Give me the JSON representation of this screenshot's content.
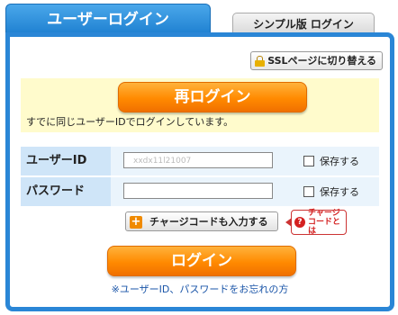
{
  "tabs": {
    "active_label": "ユーザーログイン",
    "inactive_label": "シンプル版 ログイン"
  },
  "ssl": {
    "label": "SSLページに切り替える"
  },
  "relogin": {
    "button_label": "再ログイン",
    "message": "すでに同じユーザーIDでログインしています。"
  },
  "form": {
    "user_id": {
      "label": "ユーザーID",
      "value": "xxdx11l21007",
      "save_label": "保存する"
    },
    "password": {
      "label": "パスワード",
      "value": "",
      "save_label": "保存する"
    }
  },
  "charge": {
    "button_label": "チャージコードも入力する",
    "help_line1": "チャージ",
    "help_line2": "コードとは"
  },
  "login": {
    "button_label": "ログイン"
  },
  "forgot_link": "※ユーザーID、パスワードをお忘れの方",
  "colors": {
    "accent_blue": "#2a86d6",
    "button_orange": "#ff8a00",
    "relogin_bg": "#fffbcc"
  }
}
